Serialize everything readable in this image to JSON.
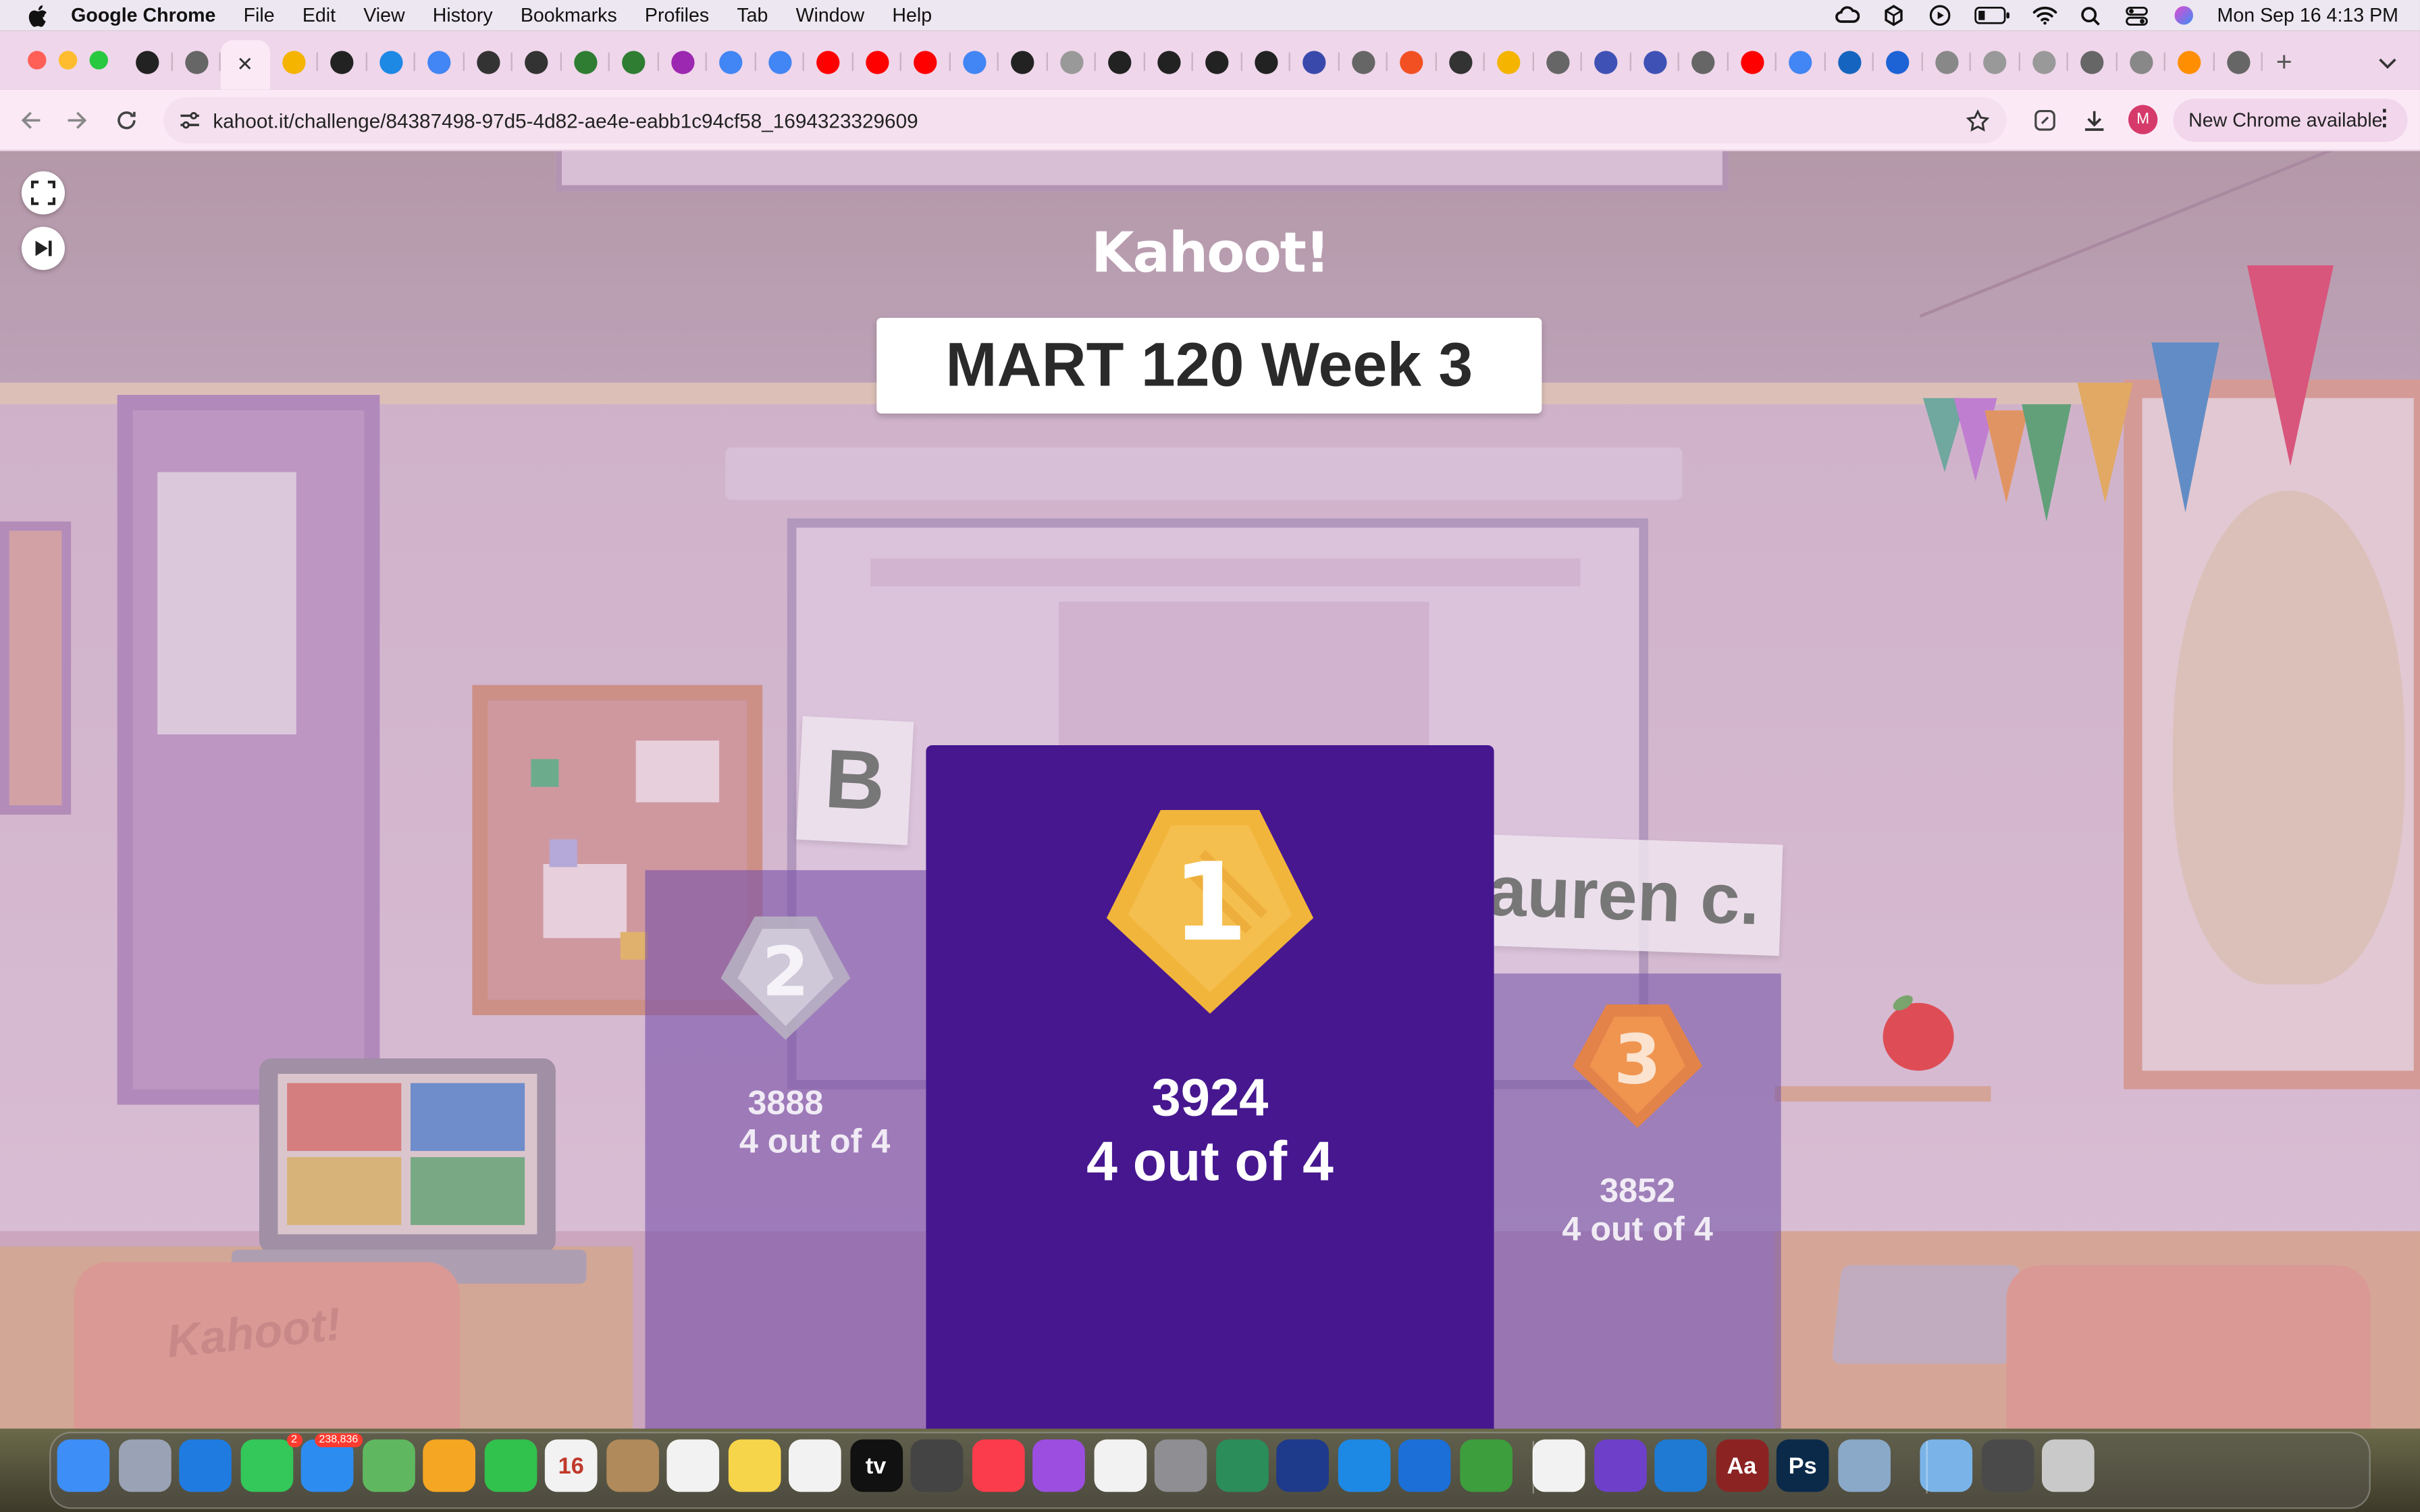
{
  "menubar": {
    "app_name": "Google Chrome",
    "menus": [
      "File",
      "Edit",
      "View",
      "History",
      "Bookmarks",
      "Profiles",
      "Tab",
      "Window",
      "Help"
    ],
    "clock": "Mon Sep 16  4:13 PM"
  },
  "browser": {
    "url": "kahoot.it/challenge/84387498-97d5-4d82-ae4e-eabb1c94cf58_1694323329609",
    "update_label": "New Chrome available",
    "profile_initial": "M",
    "active_tab_icon": "close-icon"
  },
  "tabs": [
    {
      "icon": "github-icon",
      "color": "#222"
    },
    {
      "icon": "loading-arc-icon",
      "color": "#666"
    },
    {
      "icon": "close-icon",
      "color": "#333",
      "active": true
    },
    {
      "icon": "doc-yellow-icon",
      "color": "#f4b400"
    },
    {
      "icon": "openai-icon",
      "color": "#222"
    },
    {
      "icon": "edge-icon",
      "color": "#1e88e5"
    },
    {
      "icon": "google-icon",
      "color": "#4285f4"
    },
    {
      "icon": "swirl-icon",
      "color": "#333"
    },
    {
      "icon": "infinity-icon",
      "color": "#333"
    },
    {
      "icon": "grid-green-icon",
      "color": "#2e7d32"
    },
    {
      "icon": "grid-green-icon",
      "color": "#2e7d32"
    },
    {
      "icon": "p-purple-icon",
      "color": "#9c27b0"
    },
    {
      "icon": "google-icon",
      "color": "#4285f4"
    },
    {
      "icon": "google-icon",
      "color": "#4285f4"
    },
    {
      "icon": "youtube-icon",
      "color": "#ff0000"
    },
    {
      "icon": "youtube-icon",
      "color": "#ff0000"
    },
    {
      "icon": "youtube-icon",
      "color": "#ff0000"
    },
    {
      "icon": "docs-icon",
      "color": "#4285f4"
    },
    {
      "icon": "github-icon",
      "color": "#222"
    },
    {
      "icon": "github-light-icon",
      "color": "#999"
    },
    {
      "icon": "qr-icon",
      "color": "#222"
    },
    {
      "icon": "qr-icon",
      "color": "#222"
    },
    {
      "icon": "qr-icon",
      "color": "#222"
    },
    {
      "icon": "qr-icon",
      "color": "#222"
    },
    {
      "icon": "shield-blue-icon",
      "color": "#3949ab"
    },
    {
      "icon": "loading-arc-icon",
      "color": "#666"
    },
    {
      "icon": "microsoft-icon",
      "color": "#f25022"
    },
    {
      "icon": "contact-card-icon",
      "color": "#333"
    },
    {
      "icon": "doc-yellow-icon",
      "color": "#f4b400"
    },
    {
      "icon": "loading-arc-icon",
      "color": "#666"
    },
    {
      "icon": "at-sign-icon",
      "color": "#3f51b5"
    },
    {
      "icon": "at-sign-icon",
      "color": "#3f51b5"
    },
    {
      "icon": "loading-arc-icon",
      "color": "#666"
    },
    {
      "icon": "youtube-icon",
      "color": "#ff0000"
    },
    {
      "icon": "google-icon",
      "color": "#4285f4"
    },
    {
      "icon": "refresh-blue-icon",
      "color": "#1565c0"
    },
    {
      "icon": "f-blue-icon",
      "color": "#1e63d6"
    },
    {
      "icon": "apple-icon",
      "color": "#888"
    },
    {
      "icon": "github-light-icon",
      "color": "#999"
    },
    {
      "icon": "github-light-icon",
      "color": "#999"
    },
    {
      "icon": "loading-arc-icon",
      "color": "#666"
    },
    {
      "icon": "globe-icon",
      "color": "#888"
    },
    {
      "icon": "q-orange-icon",
      "color": "#ff8f00"
    },
    {
      "icon": "loading-arc-icon",
      "color": "#666"
    }
  ],
  "kahoot": {
    "logo": "Kahoot!",
    "title": "MART 120 Week 3",
    "podium": {
      "first": {
        "rank": "1",
        "name": "",
        "score": "3924",
        "result": "4 out of 4"
      },
      "second": {
        "rank": "2",
        "name": "B",
        "score": "3888",
        "result": "4 out of 4"
      },
      "third": {
        "rank": "3",
        "name": "auren c.",
        "score": "3852",
        "result": "4 out of 4"
      }
    },
    "colors": {
      "first_podium": "#46178f",
      "gold": "#f2b53c",
      "silver": "#c9c3cf",
      "bronze": "#f18a3c"
    },
    "background_chair_logo": "Kahoot!"
  },
  "dock": {
    "apps": [
      {
        "name": "finder-icon",
        "color": "#3e8ef7",
        "label": ""
      },
      {
        "name": "launchpad-icon",
        "color": "#9aa3b5",
        "label": ""
      },
      {
        "name": "safari-icon",
        "color": "#1f7be0",
        "label": ""
      },
      {
        "name": "messages-icon",
        "color": "#34c759",
        "label": "",
        "badge": "2"
      },
      {
        "name": "mail-icon",
        "color": "#2d8cf0",
        "label": "",
        "badge": "238,836"
      },
      {
        "name": "maps-icon",
        "color": "#5fb85f",
        "label": ""
      },
      {
        "name": "photos-icon",
        "color": "#f5a623",
        "label": ""
      },
      {
        "name": "facetime-icon",
        "color": "#31c14d",
        "label": ""
      },
      {
        "name": "calendar-icon",
        "color": "#f2f2f2",
        "label": "16"
      },
      {
        "name": "contacts-icon",
        "color": "#b08a5a",
        "label": ""
      },
      {
        "name": "reminders-icon",
        "color": "#f2f2f2",
        "label": ""
      },
      {
        "name": "notes-icon",
        "color": "#f7d54a",
        "label": ""
      },
      {
        "name": "freeform-icon",
        "color": "#f2f2f2",
        "label": ""
      },
      {
        "name": "apple-tv-icon",
        "color": "#111",
        "label": "tv"
      },
      {
        "name": "unity-icon",
        "color": "#444",
        "label": ""
      },
      {
        "name": "music-icon",
        "color": "#fa3c4c",
        "label": ""
      },
      {
        "name": "podcasts-icon",
        "color": "#9b4ee0",
        "label": ""
      },
      {
        "name": "news-icon",
        "color": "#f2f2f2",
        "label": ""
      },
      {
        "name": "system-settings-icon",
        "color": "#8e8e93",
        "label": ""
      },
      {
        "name": "audio-app-icon",
        "color": "#2a8d5a",
        "label": ""
      },
      {
        "name": "soundwave-icon",
        "color": "#1e3a8a",
        "label": ""
      },
      {
        "name": "app-store-icon",
        "color": "#1e88e5",
        "label": ""
      },
      {
        "name": "xcode-icon",
        "color": "#1b6fd6",
        "label": ""
      },
      {
        "name": "minecraft-icon",
        "color": "#3c9e3c",
        "label": ""
      },
      {
        "name": "chrome-icon",
        "color": "#f2f2f2",
        "label": ""
      },
      {
        "name": "github-desktop-icon",
        "color": "#6e40c9",
        "label": ""
      },
      {
        "name": "vscode-icon",
        "color": "#1e7ad3",
        "label": ""
      },
      {
        "name": "dictionary-icon",
        "color": "#8b2323",
        "label": "Aa"
      },
      {
        "name": "photoshop-icon",
        "color": "#0b2a4a",
        "label": "Ps"
      },
      {
        "name": "preview-icon",
        "color": "#8aa8c8",
        "label": ""
      },
      {
        "name": "folder-downloads-icon",
        "color": "#7ab3e8",
        "label": ""
      },
      {
        "name": "screenshot-icon",
        "color": "#4a4a4a",
        "label": ""
      },
      {
        "name": "trash-icon",
        "color": "#c9c9c9",
        "label": ""
      }
    ]
  }
}
